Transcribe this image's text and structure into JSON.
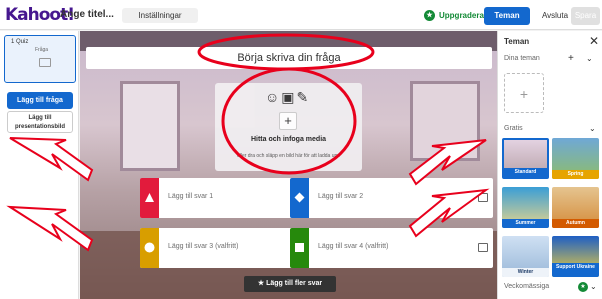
{
  "topbar": {
    "logo": "Kahoot!",
    "title_placeholder": "Ange titel...",
    "settings_label": "Inställningar",
    "upgrade_label": "Uppgradera",
    "themes_label": "Teman",
    "exit_label": "Avsluta",
    "save_label": "Spara"
  },
  "leftbar": {
    "slide": {
      "number": "1",
      "type": "Quiz",
      "label": "Fråga"
    },
    "add_question_label": "Lägg till fråga",
    "add_presentation_label_line1": "Lägg till",
    "add_presentation_label_line2": "presentationsbild"
  },
  "editor": {
    "question_placeholder": "Börja skriva din fråga",
    "media_title": "Hitta och infoga media",
    "media_hint": "eller dra och släpp en bild här för att ladda upp",
    "answers": [
      {
        "label": "Lägg till svar 1",
        "color": "#e21b3c",
        "shape": "triangle"
      },
      {
        "label": "Lägg till svar 2",
        "color": "#1368ce",
        "shape": "diamond"
      },
      {
        "label": "Lägg till svar 3 (valfritt)",
        "color": "#d89e00",
        "shape": "circle"
      },
      {
        "label": "Lägg till svar 4 (valfritt)",
        "color": "#26890c",
        "shape": "square"
      }
    ],
    "more_answers_label": "Lägg till fler svar"
  },
  "rightbar": {
    "title": "Teman",
    "your_themes_label": "Dina teman",
    "free_label": "Gratis",
    "themes": [
      "Standard",
      "Spring",
      "Summer",
      "Autumn",
      "Winter",
      "Support Ukraine"
    ],
    "weekly_label": "Veckomässiga"
  },
  "annotation_color": "#e8001c"
}
